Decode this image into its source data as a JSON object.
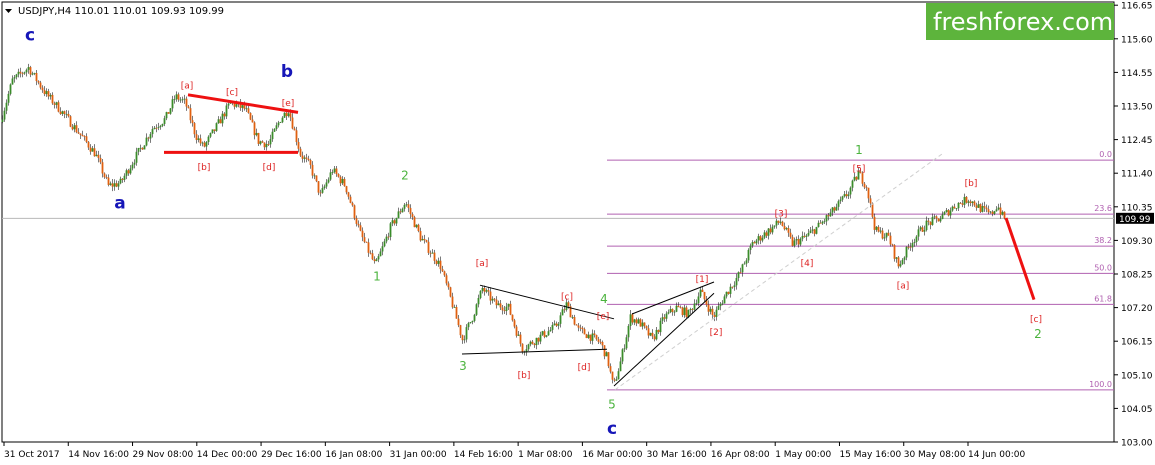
{
  "header": {
    "symbol_line": "USDJPY,H4  110.01 110.01 109.93 109.99",
    "menu_icon": "triangle-down-icon"
  },
  "brand": {
    "logo_text": "freshforex.com",
    "bg": "#5db43c"
  },
  "price_tag": {
    "text": "109.99",
    "value": 109.99
  },
  "colors": {
    "up": "#3a8c2a",
    "down": "#e06010",
    "wick": "#222222",
    "fib": "#b060b0",
    "wave_red": "#dd2222",
    "wave_green": "#4bb33d",
    "wave_blue": "#1616b8",
    "trend_red": "#ee1111",
    "grid": "#b8b8b8"
  },
  "chart_data": {
    "type": "candlestick",
    "timeframe": "H4",
    "ylim": [
      103.0,
      116.75
    ],
    "y_ticks": [
      103.0,
      104.05,
      105.1,
      106.15,
      107.2,
      108.25,
      109.3,
      110.35,
      111.4,
      112.45,
      113.5,
      114.55,
      115.6,
      116.65
    ],
    "x_ticks": [
      "31 Oct 2017",
      "14 Nov 16:00",
      "29 Nov 08:00",
      "14 Dec 00:00",
      "29 Dec 16:00",
      "16 Jan 08:00",
      "31 Jan 00:00",
      "14 Feb 16:00",
      "1 Mar 08:00",
      "16 Mar 00:00",
      "30 Mar 16:00",
      "16 Apr 08:00",
      "1 May 00:00",
      "15 May 16:00",
      "30 May 08:00",
      "14 Jun 00:00"
    ],
    "price_path": [
      [
        0,
        113.0
      ],
      [
        12,
        114.3
      ],
      [
        28,
        114.7
      ],
      [
        45,
        113.9
      ],
      [
        62,
        113.3
      ],
      [
        80,
        112.6
      ],
      [
        95,
        112.0
      ],
      [
        108,
        111.0
      ],
      [
        120,
        111.1
      ],
      [
        135,
        111.9
      ],
      [
        152,
        112.8
      ],
      [
        165,
        113.1
      ],
      [
        175,
        113.8
      ],
      [
        185,
        113.6
      ],
      [
        195,
        112.6
      ],
      [
        203,
        112.2
      ],
      [
        215,
        112.8
      ],
      [
        230,
        113.6
      ],
      [
        245,
        113.4
      ],
      [
        258,
        112.4
      ],
      [
        268,
        112.3
      ],
      [
        280,
        113.1
      ],
      [
        288,
        113.4
      ],
      [
        300,
        112.0
      ],
      [
        310,
        111.6
      ],
      [
        320,
        110.7
      ],
      [
        332,
        111.5
      ],
      [
        345,
        111.0
      ],
      [
        360,
        109.5
      ],
      [
        375,
        108.5
      ],
      [
        390,
        109.7
      ],
      [
        405,
        110.5
      ],
      [
        420,
        109.4
      ],
      [
        440,
        108.5
      ],
      [
        452,
        107.3
      ],
      [
        462,
        106.2
      ],
      [
        472,
        106.9
      ],
      [
        482,
        107.8
      ],
      [
        495,
        107.3
      ],
      [
        508,
        107.2
      ],
      [
        522,
        105.9
      ],
      [
        540,
        106.3
      ],
      [
        555,
        106.6
      ],
      [
        566,
        107.3
      ],
      [
        578,
        106.5
      ],
      [
        590,
        106.3
      ],
      [
        600,
        106.1
      ],
      [
        607,
        105.6
      ],
      [
        613,
        104.7
      ],
      [
        620,
        105.5
      ],
      [
        630,
        106.9
      ],
      [
        640,
        106.7
      ],
      [
        652,
        106.2
      ],
      [
        664,
        106.9
      ],
      [
        676,
        107.2
      ],
      [
        688,
        107.0
      ],
      [
        700,
        107.7
      ],
      [
        713,
        106.9
      ],
      [
        725,
        107.6
      ],
      [
        740,
        108.3
      ],
      [
        752,
        109.2
      ],
      [
        768,
        109.6
      ],
      [
        780,
        109.9
      ],
      [
        792,
        109.2
      ],
      [
        805,
        109.4
      ],
      [
        820,
        109.8
      ],
      [
        835,
        110.3
      ],
      [
        848,
        110.8
      ],
      [
        858,
        111.4
      ],
      [
        866,
        111.0
      ],
      [
        875,
        109.6
      ],
      [
        888,
        109.4
      ],
      [
        898,
        108.5
      ],
      [
        910,
        109.2
      ],
      [
        925,
        109.8
      ],
      [
        940,
        110.0
      ],
      [
        955,
        110.4
      ],
      [
        968,
        110.6
      ],
      [
        980,
        110.3
      ],
      [
        990,
        110.1
      ],
      [
        997,
        110.4
      ],
      [
        1003,
        109.99
      ]
    ],
    "fibonacci_levels": [
      {
        "label": "0.0",
        "price": 111.81
      },
      {
        "label": "23.6",
        "price": 110.12
      },
      {
        "label": "38.2",
        "price": 109.12
      },
      {
        "label": "50.0",
        "price": 108.27
      },
      {
        "label": "61.8",
        "price": 107.3
      },
      {
        "label": "100.0",
        "price": 104.63
      }
    ],
    "wave_labels": [
      {
        "text": "c",
        "color": "blue",
        "bar": 28,
        "price": 115.55
      },
      {
        "text": "a",
        "color": "blue",
        "bar": 118,
        "price": 110.3
      },
      {
        "text": "b",
        "color": "blue",
        "bar": 285,
        "price": 114.4
      },
      {
        "text": "[a]",
        "color": "red",
        "bar": 185,
        "price": 114.05
      },
      {
        "text": "[b]",
        "color": "red",
        "bar": 202,
        "price": 111.5
      },
      {
        "text": "[c]",
        "color": "red",
        "bar": 230,
        "price": 113.85
      },
      {
        "text": "[d]",
        "color": "red",
        "bar": 267,
        "price": 111.5
      },
      {
        "text": "[e]",
        "color": "red",
        "bar": 286,
        "price": 113.5
      },
      {
        "text": "2",
        "color": "green",
        "bar": 403,
        "price": 111.2
      },
      {
        "text": "1",
        "color": "green",
        "bar": 375,
        "price": 108.05
      },
      {
        "text": "[a]",
        "color": "red",
        "bar": 480,
        "price": 108.5
      },
      {
        "text": "3",
        "color": "green",
        "bar": 461,
        "price": 105.25
      },
      {
        "text": "[b]",
        "color": "red",
        "bar": 522,
        "price": 105.0
      },
      {
        "text": "[c]",
        "color": "red",
        "bar": 565,
        "price": 107.45
      },
      {
        "text": "[d]",
        "color": "red",
        "bar": 582,
        "price": 105.25
      },
      {
        "text": "[e]",
        "color": "red",
        "bar": 601,
        "price": 106.85
      },
      {
        "text": "4",
        "color": "green",
        "bar": 602,
        "price": 107.35
      },
      {
        "text": "5",
        "color": "green",
        "bar": 610,
        "price": 104.05
      },
      {
        "text": "c",
        "color": "blue",
        "bar": 610,
        "price": 103.25
      },
      {
        "text": "[1]",
        "color": "red",
        "bar": 700,
        "price": 108.0
      },
      {
        "text": "[2]",
        "color": "red",
        "bar": 714,
        "price": 106.35
      },
      {
        "text": "[3]",
        "color": "red",
        "bar": 779,
        "price": 110.05
      },
      {
        "text": "[4]",
        "color": "red",
        "bar": 805,
        "price": 108.5
      },
      {
        "text": "1",
        "color": "green",
        "bar": 857,
        "price": 112.0
      },
      {
        "text": "[5]",
        "color": "red",
        "bar": 857,
        "price": 111.45
      },
      {
        "text": "[a]",
        "color": "red",
        "bar": 901,
        "price": 107.8
      },
      {
        "text": "[b]",
        "color": "red",
        "bar": 969,
        "price": 111.0
      },
      {
        "text": "[c]",
        "color": "red",
        "bar": 1034,
        "price": 106.75
      },
      {
        "text": "2",
        "color": "green",
        "bar": 1036,
        "price": 106.25
      }
    ],
    "trend_lines": [
      {
        "color": "red",
        "from": [
          186,
          113.85
        ],
        "to": [
          296,
          113.3
        ],
        "width": 3
      },
      {
        "color": "red",
        "from": [
          162,
          112.05
        ],
        "to": [
          296,
          112.05
        ],
        "width": 3
      },
      {
        "color": "black",
        "from": [
          478,
          107.9
        ],
        "to": [
          612,
          106.85
        ],
        "width": 1
      },
      {
        "color": "black",
        "from": [
          460,
          105.75
        ],
        "to": [
          605,
          105.9
        ],
        "width": 1
      },
      {
        "color": "black",
        "from": [
          630,
          107.0
        ],
        "to": [
          712,
          108.0
        ],
        "width": 1
      },
      {
        "color": "black",
        "from": [
          612,
          104.75
        ],
        "to": [
          712,
          107.65
        ],
        "width": 1
      },
      {
        "color": "fib_dashed",
        "from": [
          613,
          104.63
        ],
        "to": [
          940,
          112.0
        ],
        "width": 1
      },
      {
        "color": "red",
        "from": [
          1004,
          110.0
        ],
        "to": [
          1032,
          107.45
        ],
        "width": 3
      }
    ]
  }
}
